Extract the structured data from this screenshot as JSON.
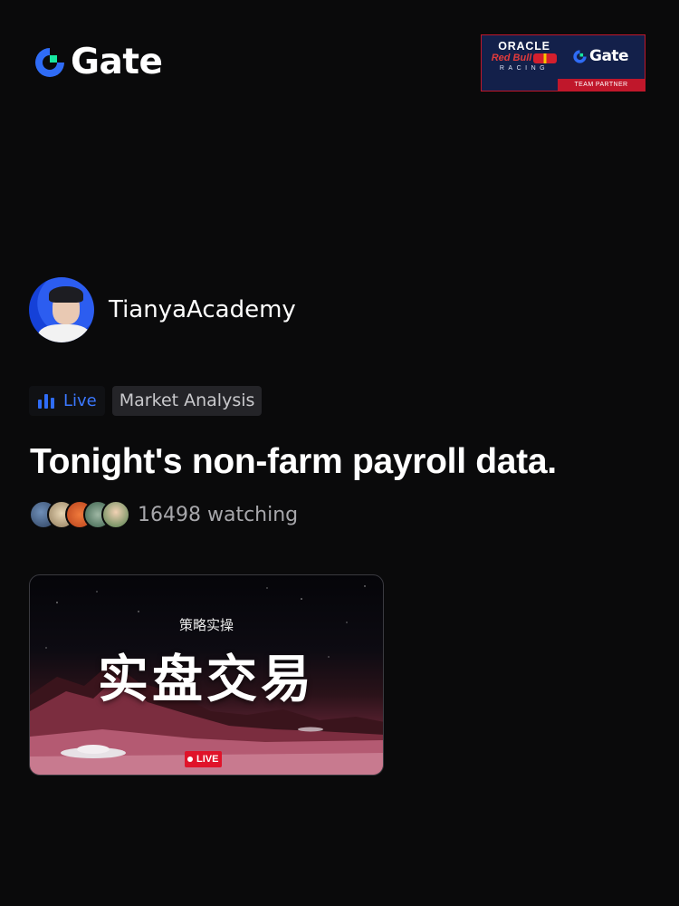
{
  "header": {
    "brand": "Gate",
    "partner": {
      "oracle": "ORACLE",
      "redbull": "Red Bull",
      "racing": "RACING",
      "brand": "Gate",
      "strip": "TEAM PARTNER"
    }
  },
  "host": {
    "name": "TianyaAcademy"
  },
  "badges": {
    "live": "Live",
    "category": "Market Analysis"
  },
  "stream": {
    "title": "Tonight's non-farm payroll data.",
    "watching": "16498 watching"
  },
  "thumbnail": {
    "subtitle": "策略实操",
    "headline": "实盘交易",
    "live_tag": "LIVE"
  },
  "colors": {
    "background": "#0a0a0b",
    "accent_blue": "#2f6cf6",
    "live_red": "#e0132a",
    "gate_green": "#17e7a0"
  },
  "icons": {
    "brand": "gate-logo-icon",
    "live": "bar-chart-icon",
    "live_dot": "live-dot-icon"
  }
}
